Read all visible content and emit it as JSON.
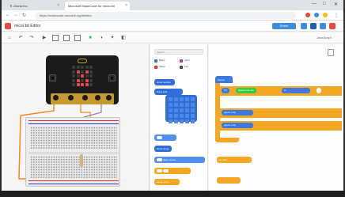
{
  "browser": {
    "tabs": [
      {
        "label": "Ｅ-Gloria Inc.",
        "active": false
      },
      {
        "label": "Microsoft MakeCode for micro:bit",
        "active": true
      }
    ],
    "url": "https://makecode.microbit.org/#editor",
    "controls": {
      "minimize": "—",
      "maximize": "□",
      "close": "✕"
    }
  },
  "app": {
    "title": "micro:bit Editor",
    "share_label": "Share",
    "colors": {
      "accent": "#3b8de0",
      "brand_red": "#e74c3c",
      "orange": "#f5a623",
      "blue_block": "#3b78e0",
      "green": "#2ecc40"
    }
  },
  "toolbar": {
    "right_label": "JavaScript"
  },
  "simulator": {
    "pin_labels": [
      "0",
      "1",
      "2",
      "3V",
      "GND"
    ],
    "led_on": [
      6,
      8,
      12,
      16,
      18,
      21,
      22,
      23
    ]
  },
  "toolbox": {
    "search_placeholder": "Search...",
    "categories": [
      {
        "label": "Basic",
        "color": "#2f6fd8"
      },
      {
        "label": "Input",
        "color": "#c0388b"
      },
      {
        "label": "Music",
        "color": "#e63022"
      },
      {
        "label": "Led",
        "color": "#5c2d91"
      }
    ],
    "blocks": {
      "show_number": "show number",
      "show_leds": "show leds",
      "show_icon": "show icon",
      "show_string": "show string",
      "clear_screen": "clear screen",
      "pause": "pause (ms)"
    }
  },
  "workspace": {
    "forever_label": "forever",
    "command_1": "digital write pin",
    "command_1_value": "P0",
    "command_1_extra": "to",
    "command_2": "pause (ms)",
    "command_3": "pause (ms)",
    "on_start": "on start"
  }
}
